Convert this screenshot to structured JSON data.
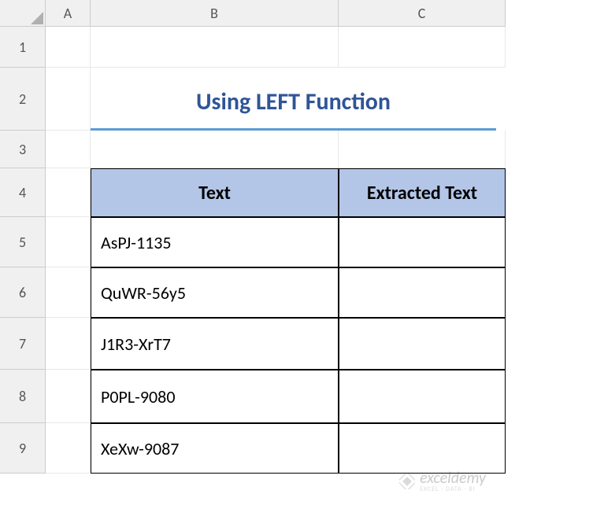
{
  "columns": [
    "A",
    "B",
    "C"
  ],
  "rows": [
    "1",
    "2",
    "3",
    "4",
    "5",
    "6",
    "7",
    "8",
    "9"
  ],
  "title": "Using LEFT Function",
  "table": {
    "headers": {
      "text": "Text",
      "extracted": "Extracted Text"
    },
    "data": [
      {
        "text": "AsPJ-1135",
        "extracted": ""
      },
      {
        "text": "QuWR-56y5",
        "extracted": ""
      },
      {
        "text": "J1R3-XrT7",
        "extracted": ""
      },
      {
        "text": "P0PL-9080",
        "extracted": ""
      },
      {
        "text": "XeXw-9087",
        "extracted": ""
      }
    ]
  },
  "watermark": {
    "main": "exceldemy",
    "sub": "EXCEL · DATA · BI"
  }
}
